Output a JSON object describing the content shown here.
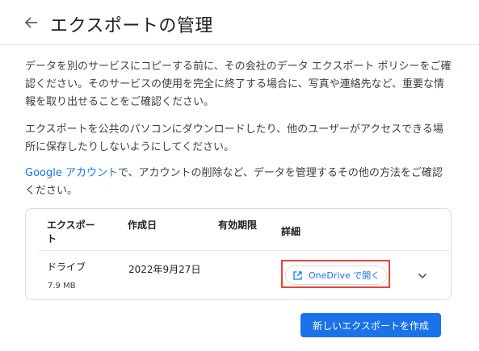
{
  "header": {
    "back_icon": "arrow-back-icon",
    "title": "エクスポートの管理"
  },
  "content": {
    "paragraph1": "データを別のサービスにコピーする前に、その会社のデータ エクスポート ポリシーをご確認ください。そのサービスの使用を完全に終了する場合に、写真や連絡先など、重要な情報を取り出せることをご確認ください。",
    "paragraph2": "エクスポートを公共のパソコンにダウンロードしたり、他のユーザーがアクセスできる場所に保存したりしないようにしてください。",
    "paragraph3_link": "Google アカウント",
    "paragraph3_rest": "で、アカウントの削除など、データを管理するその他の方法をご確認ください。"
  },
  "table": {
    "headers": {
      "export": "エクスポート",
      "created": "作成日",
      "expiry": "有効期限",
      "details": "詳細"
    },
    "rows": [
      {
        "name": "ドライブ",
        "size": "7.9 MB",
        "created": "2022年9月27日",
        "expiry": "",
        "open_label": "OneDrive で開く",
        "open_icon": "open-in-new-icon",
        "expand_icon": "chevron-down-icon"
      }
    ]
  },
  "actions": {
    "create_label": "新しいエクスポートを作成"
  },
  "colors": {
    "accent": "#1a73e8",
    "highlight": "#ea4335"
  }
}
